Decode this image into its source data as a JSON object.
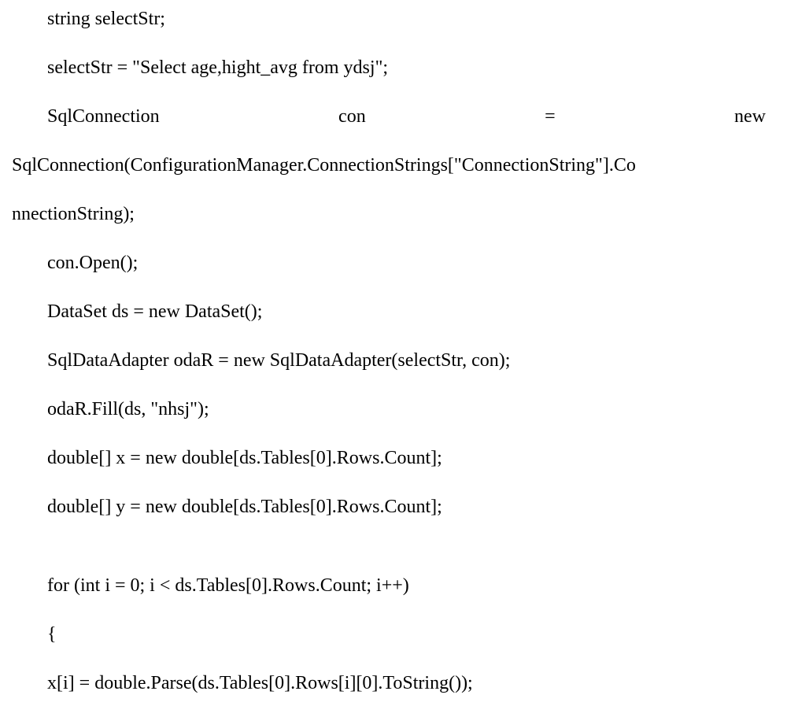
{
  "lines": {
    "l1": "string selectStr;",
    "l2": "selectStr = \"Select age,hight_avg from ydsj\";",
    "l3": "SqlConnection                                  con                                  =                                  new",
    "l4": "SqlConnection(ConfigurationManager.ConnectionStrings[\"ConnectionString\"].Co",
    "l5": "nnectionString);",
    "l6": "con.Open();",
    "l7": "DataSet ds = new DataSet();",
    "l8": "SqlDataAdapter odaR = new SqlDataAdapter(selectStr, con);",
    "l9": "odaR.Fill(ds, \"nhsj\");",
    "l10": "double[] x = new double[ds.Tables[0].Rows.Count];",
    "l11": "double[] y = new double[ds.Tables[0].Rows.Count];",
    "l12": "for (int i = 0; i < ds.Tables[0].Rows.Count; i++)",
    "l13": "{",
    "l14": "x[i] = double.Parse(ds.Tables[0].Rows[i][0].ToString());"
  }
}
